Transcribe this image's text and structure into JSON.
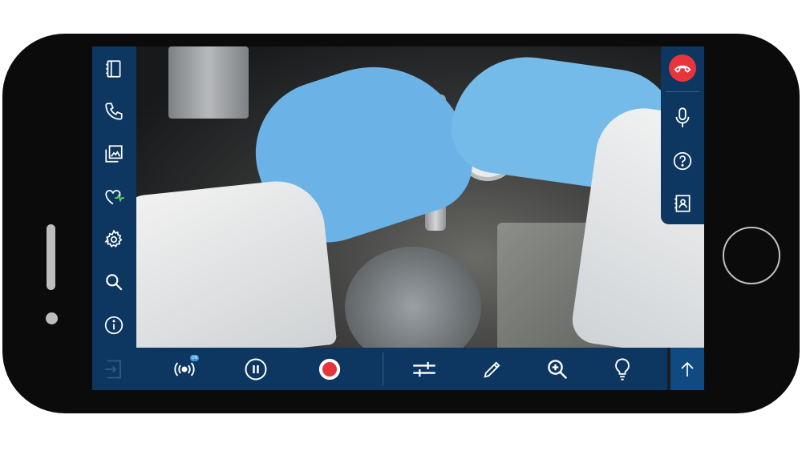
{
  "colors": {
    "toolbar_bg": "#0d3760",
    "accent_red": "#e8343c",
    "icon": "#ffffff",
    "badge": "#3b9bd7"
  },
  "left_sidebar": {
    "items": [
      {
        "name": "notebook",
        "icon": "notebook-icon"
      },
      {
        "name": "call",
        "icon": "phone-icon"
      },
      {
        "name": "gallery",
        "icon": "gallery-icon"
      },
      {
        "name": "health",
        "icon": "heart-pulse-icon"
      },
      {
        "name": "settings",
        "icon": "gear-icon"
      },
      {
        "name": "search",
        "icon": "search-icon"
      },
      {
        "name": "info",
        "icon": "info-icon"
      }
    ],
    "bottom": {
      "name": "exit",
      "icon": "exit-icon"
    }
  },
  "right_panel": {
    "items": [
      {
        "name": "hang-up",
        "icon": "phone-hangup-icon"
      },
      {
        "name": "microphone",
        "icon": "microphone-icon"
      },
      {
        "name": "help",
        "icon": "help-icon"
      },
      {
        "name": "contact",
        "icon": "contact-card-icon"
      }
    ]
  },
  "bottom_toolbar": {
    "stream_badge": "ON",
    "items": [
      {
        "name": "stream",
        "icon": "broadcast-icon"
      },
      {
        "name": "pause",
        "icon": "pause-icon"
      },
      {
        "name": "record",
        "icon": "record-icon"
      },
      {
        "name": "adjust",
        "icon": "sliders-icon"
      },
      {
        "name": "draw",
        "icon": "pencil-icon"
      },
      {
        "name": "zoom",
        "icon": "zoom-in-icon"
      },
      {
        "name": "flashlight",
        "icon": "lightbulb-icon"
      },
      {
        "name": "expand",
        "icon": "arrow-up-icon"
      }
    ]
  }
}
